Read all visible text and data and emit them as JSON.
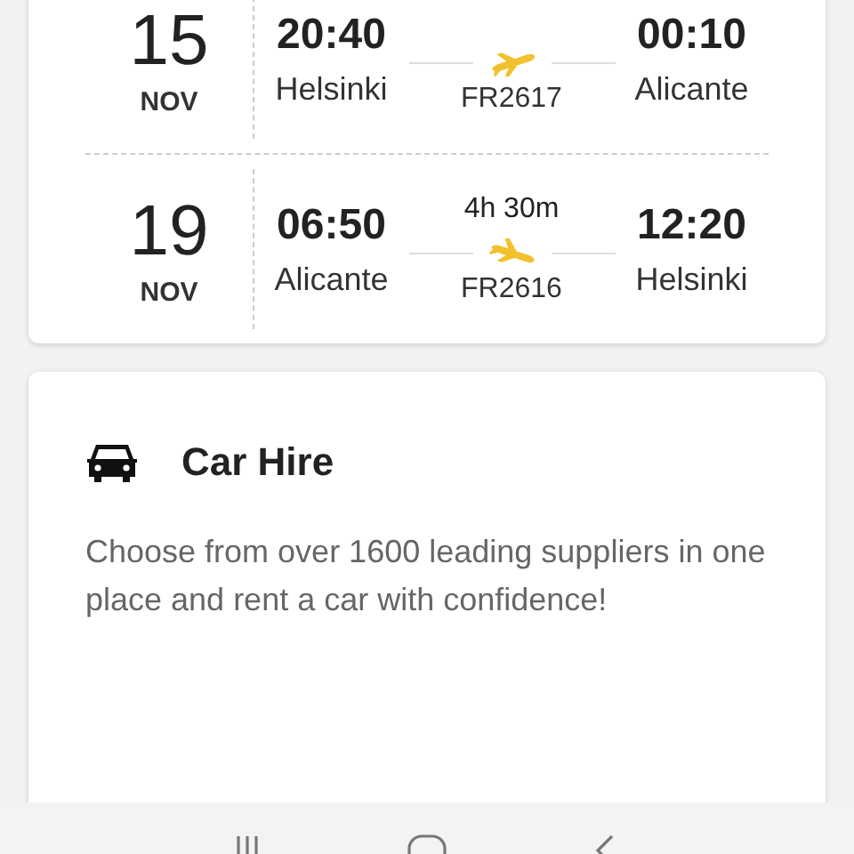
{
  "flights": [
    {
      "kind": "outbound",
      "day": "15",
      "month": "NOV",
      "dep_time": "20:40",
      "dep_city": "Helsinki",
      "flight": "FR2617",
      "arr_time": "00:10",
      "arr_city": "Alicante"
    },
    {
      "kind": "return",
      "day": "19",
      "month": "NOV",
      "dep_time": "06:50",
      "dep_city": "Alicante",
      "duration": "4h 30m",
      "flight": "FR2616",
      "arr_time": "12:20",
      "arr_city": "Helsinki"
    }
  ],
  "car_hire": {
    "title": "Car Hire",
    "description": "Choose from over 1600 leading suppliers in one place and rent a car with confidence!"
  }
}
